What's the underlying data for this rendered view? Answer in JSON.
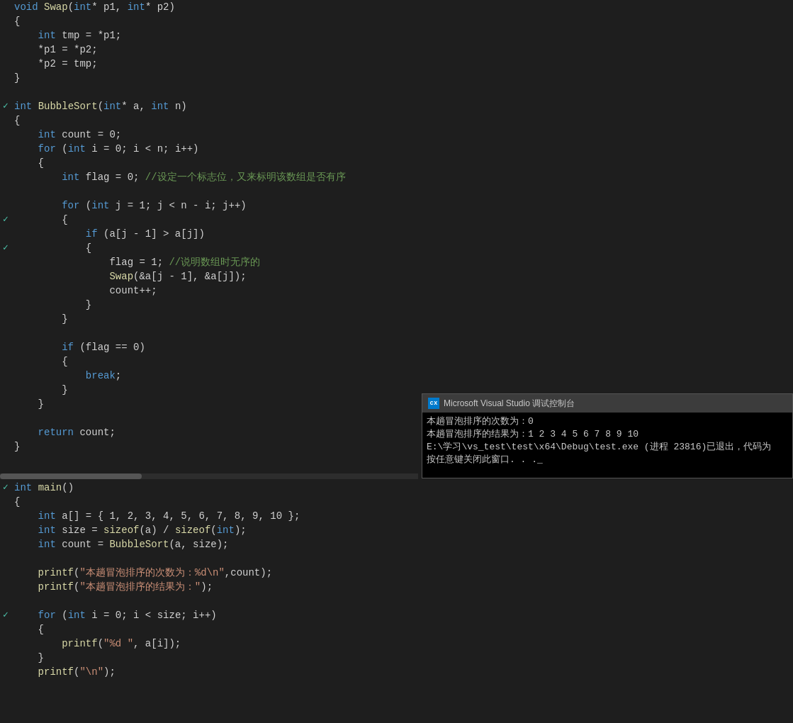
{
  "editor": {
    "background": "#1e1e1e",
    "code_lines_top": [
      {
        "indicator": "",
        "content": "<kw>void</kw> <fn>Swap</fn>(<kw>int</kw>* p1, <kw>int</kw>* p2)"
      },
      {
        "indicator": "",
        "content": "{"
      },
      {
        "indicator": "",
        "content": "    <kw>int</kw> tmp = *p1;"
      },
      {
        "indicator": "",
        "content": "    *p1 = *p2;"
      },
      {
        "indicator": "",
        "content": "    *p2 = tmp;"
      },
      {
        "indicator": "",
        "content": "}"
      },
      {
        "indicator": "",
        "content": ""
      },
      {
        "indicator": "✓",
        "content": "<kw>int</kw> <fn>BubbleSort</fn>(<kw>int</kw>* a, <kw>int</kw> n)"
      },
      {
        "indicator": "",
        "content": "{"
      },
      {
        "indicator": "",
        "content": "    <kw>int</kw> count = 0;"
      },
      {
        "indicator": "",
        "content": "    <kw>for</kw> (<kw>int</kw> i = 0; i < n; i++)"
      },
      {
        "indicator": "",
        "content": "    {"
      },
      {
        "indicator": "",
        "content": "        <kw>int</kw> flag = 0; <comment>//设定一个标志位，又来标明该数组是否有序</comment>"
      },
      {
        "indicator": "",
        "content": ""
      },
      {
        "indicator": "",
        "content": "        <kw>for</kw> (<kw>int</kw> j = 1; j < n - i; j++)"
      },
      {
        "indicator": "✓",
        "content": "        {"
      },
      {
        "indicator": "",
        "content": "            <kw>if</kw> (a[j - 1] > a[j])"
      },
      {
        "indicator": "✓",
        "content": "            {"
      },
      {
        "indicator": "",
        "content": "                flag = 1; <comment>//说明数组时无序的</comment>"
      },
      {
        "indicator": "",
        "content": "                <fn>Swap</fn>(&a[j - 1], &a[j]);"
      },
      {
        "indicator": "",
        "content": "                count++;"
      },
      {
        "indicator": "",
        "content": "            }"
      },
      {
        "indicator": "",
        "content": "        }"
      },
      {
        "indicator": "",
        "content": ""
      },
      {
        "indicator": "",
        "content": "        <kw>if</kw> (flag == 0)"
      },
      {
        "indicator": "",
        "content": "        {"
      },
      {
        "indicator": "",
        "content": "            <kw>break</kw>;"
      },
      {
        "indicator": "",
        "content": "        }"
      },
      {
        "indicator": "",
        "content": "    }"
      },
      {
        "indicator": "",
        "content": ""
      },
      {
        "indicator": "",
        "content": "    <kw>return</kw> count;"
      },
      {
        "indicator": "",
        "content": "}"
      }
    ],
    "code_lines_bottom": [
      {
        "indicator": "✓",
        "content": "<kw>int</kw> <fn>main</fn>()"
      },
      {
        "indicator": "",
        "content": "{"
      },
      {
        "indicator": "",
        "content": "    <kw>int</kw> a[] = { 1, 2, 3, 4, 5, 6, 7, 8, 9, 10 };"
      },
      {
        "indicator": "",
        "content": "    <kw>int</kw> size = <fn>sizeof</fn>(a) / <fn>sizeof</fn>(<kw>int</kw>);"
      },
      {
        "indicator": "",
        "content": "    <kw>int</kw> count = <fn>BubbleSort</fn>(a, size);"
      },
      {
        "indicator": "",
        "content": ""
      },
      {
        "indicator": "",
        "content": "    <fn>printf</fn>(\"本趟冒泡排序的次数为：%d\\n\",count);"
      },
      {
        "indicator": "",
        "content": "    <fn>printf</fn>(\"本趟冒泡排序的结果为：\");"
      },
      {
        "indicator": "",
        "content": ""
      },
      {
        "indicator": "✓",
        "content": "    <kw>for</kw> (<kw>int</kw> i = 0; i < size; i++)"
      },
      {
        "indicator": "",
        "content": "    {"
      },
      {
        "indicator": "",
        "content": "        <fn>printf</fn>(\"%d \", a[i]);"
      },
      {
        "indicator": "",
        "content": "    }"
      },
      {
        "indicator": "",
        "content": "    <fn>printf</fn>(\"\\n\");"
      }
    ]
  },
  "console": {
    "title": "Microsoft Visual Studio 调试控制台",
    "icon_text": "cx",
    "lines": [
      "本趟冒泡排序的次数为：0",
      "本趟冒泡排序的结果为：1 2 3 4 5 6 7 8 9 10",
      "",
      "E:\\学习\\vs_test\\test\\x64\\Debug\\test.exe (进程 23816)已退出，代码为",
      "按任意键关闭此窗口. . ._"
    ]
  }
}
